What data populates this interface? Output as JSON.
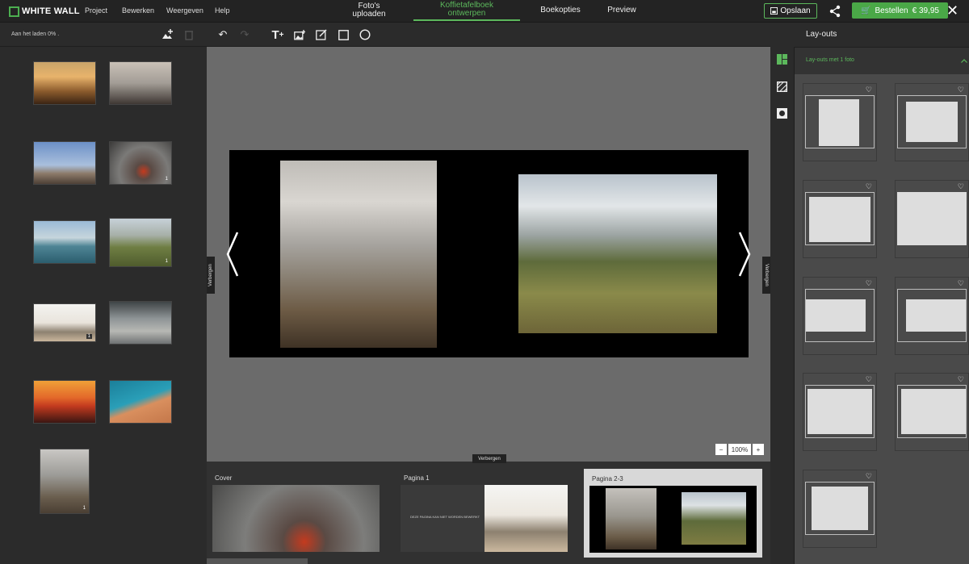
{
  "app": {
    "logo_text": "WHITE WALL"
  },
  "menu": [
    "Project",
    "Bewerken",
    "Weergeven",
    "Help"
  ],
  "steps": [
    {
      "label": "Foto's uploaden",
      "active": false
    },
    {
      "label": "Koffietafelboek ontwerpen",
      "active": true
    },
    {
      "label": "Boekopties",
      "active": false
    },
    {
      "label": "Preview",
      "active": false
    }
  ],
  "actions": {
    "save_label": "Opslaan",
    "order_label": "Bestellen",
    "price": "€ 39,95"
  },
  "left_panel": {
    "loading_text": "Aan het laden 0% .",
    "thumbnail_badges": [
      "1",
      "1",
      "1",
      "1"
    ]
  },
  "canvas": {
    "hide_label": "Verbergen",
    "zoom_value": "100%",
    "zoom_minus": "−",
    "zoom_plus": "+"
  },
  "filmstrip": {
    "hide_label": "Verbergen",
    "pages": [
      "Cover",
      "Pagina 1",
      "Pagina 2-3"
    ],
    "page1_text": "DEZE PAGINA KAN NIET WORDEN BEWERKT"
  },
  "right_panel": {
    "title": "Lay-outs",
    "section_label": "Lay-outs met 1 foto",
    "hide_label": "Verbergen"
  },
  "colors": {
    "accent": "#5cb85c",
    "order_button": "#4aa847",
    "canvas_bg": "#6b6b6b"
  }
}
